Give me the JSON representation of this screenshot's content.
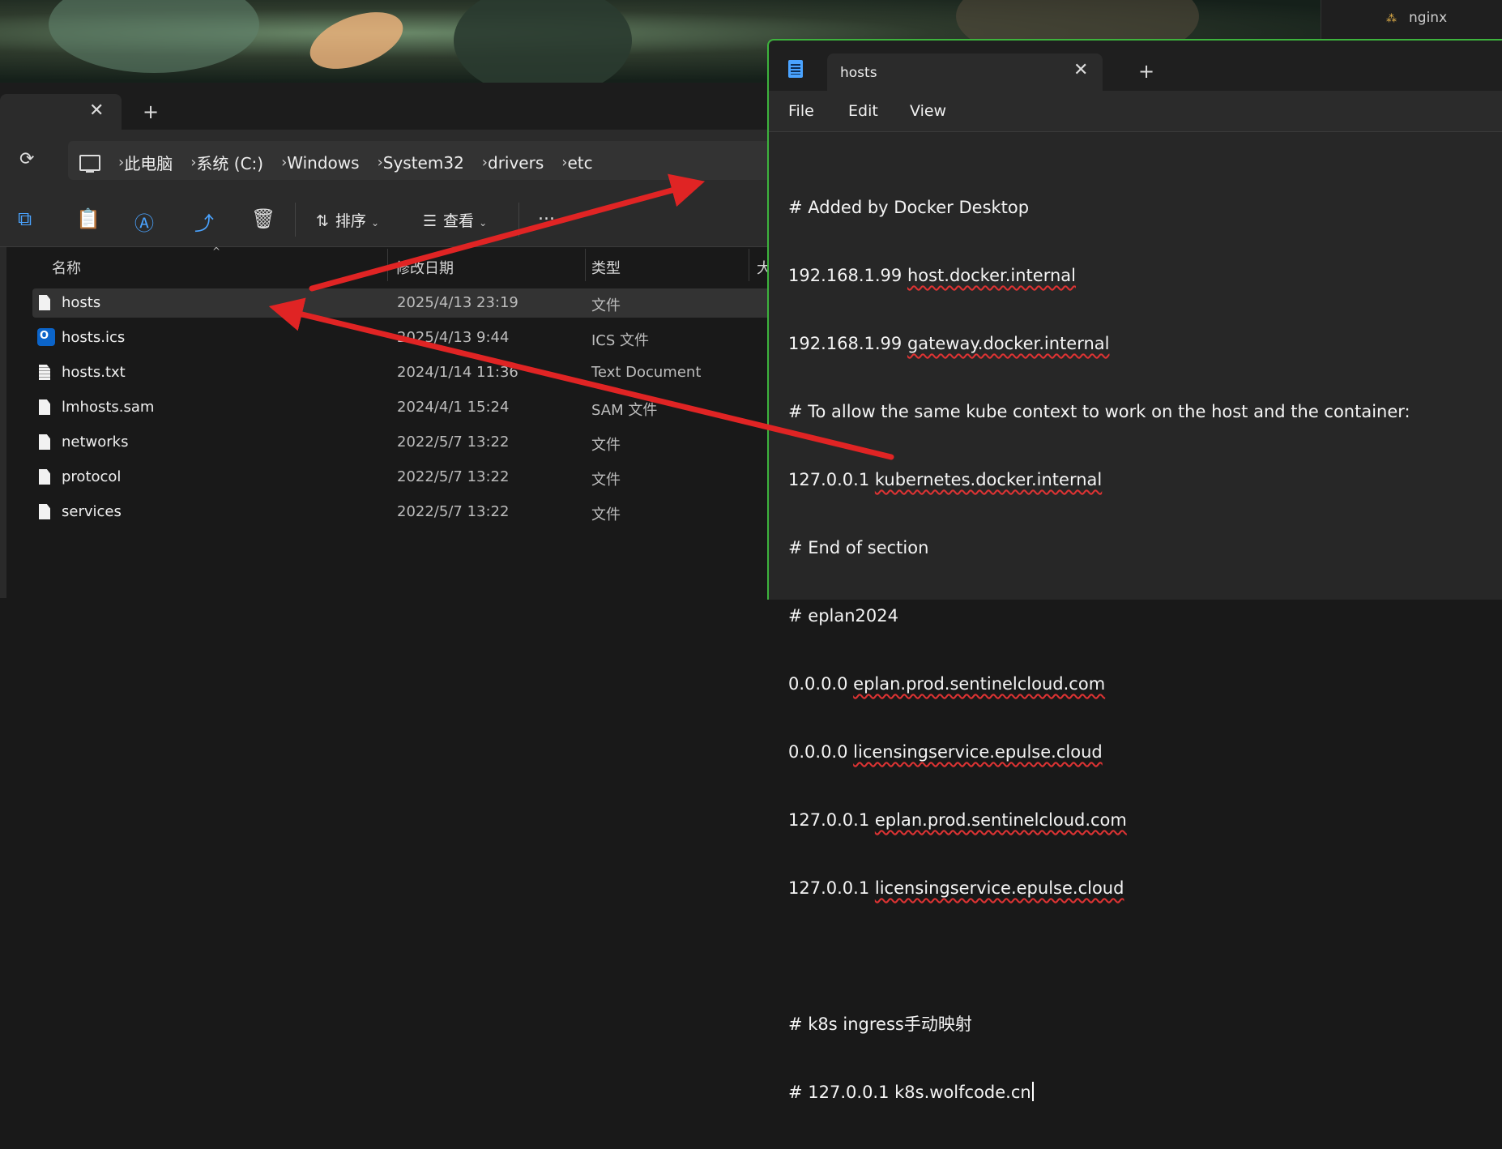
{
  "explorer": {
    "breadcrumb": [
      "此电脑",
      "系统 (C:)",
      "Windows",
      "System32",
      "drivers",
      "etc"
    ],
    "toolbar": {
      "sort_label": "排序",
      "view_label": "查看",
      "more": "..."
    },
    "columns": [
      "名称",
      "修改日期",
      "类型",
      "大"
    ],
    "files": [
      {
        "name": "hosts",
        "date": "2025/4/13 23:19",
        "type": "文件",
        "icon": "file-icon"
      },
      {
        "name": "hosts.ics",
        "date": "2025/4/13 9:44",
        "type": "ICS 文件",
        "icon": "outlook-icon"
      },
      {
        "name": "hosts.txt",
        "date": "2024/1/14 11:36",
        "type": "Text Document",
        "icon": "text-file-icon"
      },
      {
        "name": "lmhosts.sam",
        "date": "2024/4/1 15:24",
        "type": "SAM 文件",
        "icon": "file-icon"
      },
      {
        "name": "networks",
        "date": "2022/5/7 13:22",
        "type": "文件",
        "icon": "file-icon"
      },
      {
        "name": "protocol",
        "date": "2022/5/7 13:22",
        "type": "文件",
        "icon": "file-icon"
      },
      {
        "name": "services",
        "date": "2022/5/7 13:22",
        "type": "文件",
        "icon": "file-icon"
      }
    ]
  },
  "notepad": {
    "tab_title": "hosts",
    "menu": [
      "File",
      "Edit",
      "View"
    ],
    "lines": [
      "# Added by Docker Desktop",
      "192.168.1.99 host.docker.internal",
      "192.168.1.99 gateway.docker.internal",
      "# To allow the same kube context to work on the host and the container:",
      "127.0.0.1 kubernetes.docker.internal",
      "# End of section",
      "# eplan2024",
      "0.0.0.0 eplan.prod.sentinelcloud.com",
      "0.0.0.0 licensingservice.epulse.cloud",
      "127.0.0.1 eplan.prod.sentinelcloud.com",
      "127.0.0.1 licensingservice.epulse.cloud",
      "",
      "# k8s ingress手动映射",
      "# 127.0.0.1 k8s.wolfcode.cn"
    ]
  },
  "background_window": {
    "item": "nginx"
  },
  "colors": {
    "accent": "#4aa3ff",
    "annotation_arrow": "#e02424",
    "window_border": "#3db33d"
  }
}
